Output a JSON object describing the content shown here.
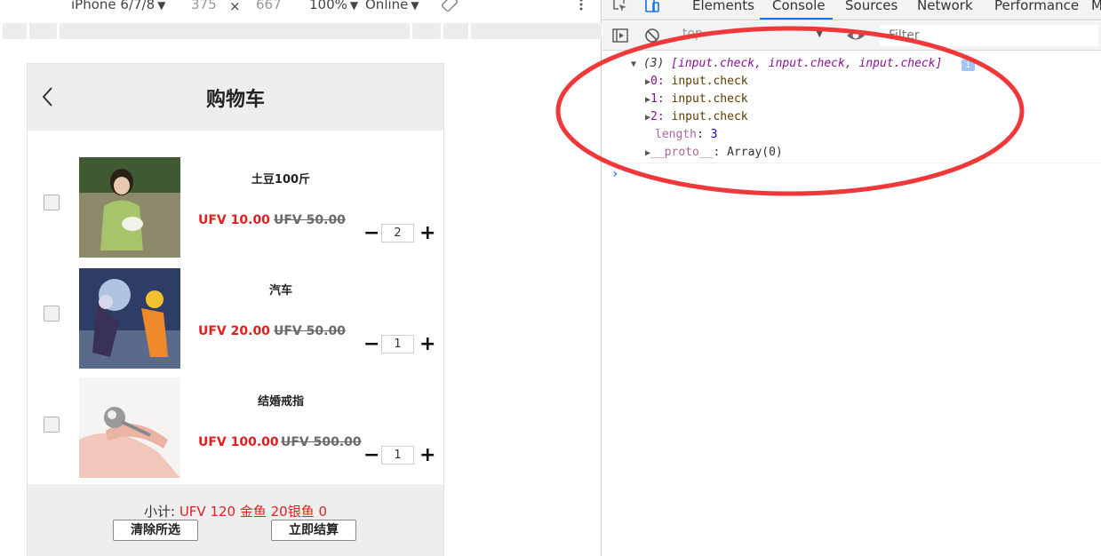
{
  "device_toolbar": {
    "device": "iPhone 6/7/8",
    "width": "375",
    "times": "×",
    "height": "667",
    "zoom": "100%",
    "network": "Online"
  },
  "cart": {
    "title": "购物车",
    "items": [
      {
        "name": "土豆100斤",
        "price": "UFV 10.00",
        "old_price": "UFV 50.00",
        "qty": "2"
      },
      {
        "name": "汽车",
        "price": "UFV 20.00",
        "old_price": "UFV 50.00",
        "qty": "1"
      },
      {
        "name": "结婚戒指",
        "price": "UFV 100.00",
        "old_price": "UFV 500.00",
        "qty": "1"
      }
    ],
    "minus": "−",
    "plus": "+",
    "subtotal_label": "小计: ",
    "subtotal_value": "UFV 120 金鱼 20银鱼 0",
    "clear_button": "清除所选",
    "checkout_button": "立即结算"
  },
  "devtools": {
    "tabs": [
      "Elements",
      "Console",
      "Sources",
      "Network",
      "Performance",
      "M"
    ],
    "active_tab": "Console",
    "context": "top",
    "filter_placeholder": "Filter",
    "log": {
      "summary_count": "(3)",
      "summary_items": "[input.check, input.check, input.check]",
      "entries": [
        {
          "index": "0:",
          "value": "input.check"
        },
        {
          "index": "1:",
          "value": "input.check"
        },
        {
          "index": "2:",
          "value": "input.check"
        }
      ],
      "length_key": "length",
      "length_value": "3",
      "proto_key": "__proto__",
      "proto_value": "Array(0)"
    }
  },
  "colors": {
    "price_red": "#e02020",
    "annotation_red": "#f0373a",
    "devtools_blue": "#1a73e8"
  }
}
